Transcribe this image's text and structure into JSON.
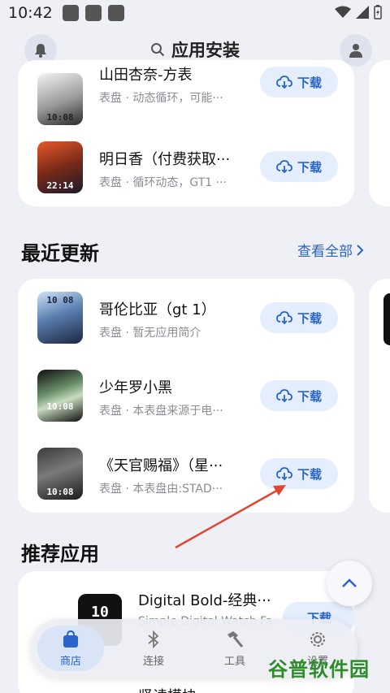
{
  "status_bar": {
    "time": "10:42"
  },
  "header": {
    "title": "应用安装"
  },
  "top_list": [
    {
      "title": "山田杏奈-方表",
      "subtitle": "表盘 · 动态循环，可能···",
      "thumb_time": "10:08"
    },
    {
      "title": "明日香（付费获取···",
      "subtitle": "表盘 · 循环动态，GT1 ···",
      "thumb_time": "22:14"
    }
  ],
  "recent": {
    "title": "最近更新",
    "see_all": "查看全部",
    "items": [
      {
        "title": "哥伦比亚（gt 1）",
        "subtitle": "表盘 · 暂无应用简介",
        "thumb_time": "10 08"
      },
      {
        "title": "少年罗小黑",
        "subtitle": "表盘 · 本表盘来源于电···",
        "thumb_time": "10:08"
      },
      {
        "title": "《天官赐福》（星···",
        "subtitle": "表盘 · 本表盘由:STAD···",
        "thumb_time": "10:08"
      }
    ]
  },
  "recommended": {
    "title": "推荐应用",
    "items": [
      {
        "title": "Digital Bold-经典···",
        "subtitle": "Simple Digital Watch Fa",
        "thumb_time": "10"
      },
      {
        "title": "竖读模块",
        "subtitle": ""
      }
    ]
  },
  "download_label": "下载",
  "tabs": [
    {
      "label": "商店",
      "icon": "bag-icon",
      "active": true
    },
    {
      "label": "连接",
      "icon": "bluetooth-icon",
      "active": false
    },
    {
      "label": "工具",
      "icon": "hammer-icon",
      "active": false
    },
    {
      "label": "设置",
      "icon": "gear-icon",
      "active": false
    }
  ],
  "watermark": "谷普软件园",
  "colors": {
    "accent": "#2a64c8",
    "button_bg": "#e4eefc",
    "background": "#eef0f6",
    "arrow": "#e0462f"
  }
}
